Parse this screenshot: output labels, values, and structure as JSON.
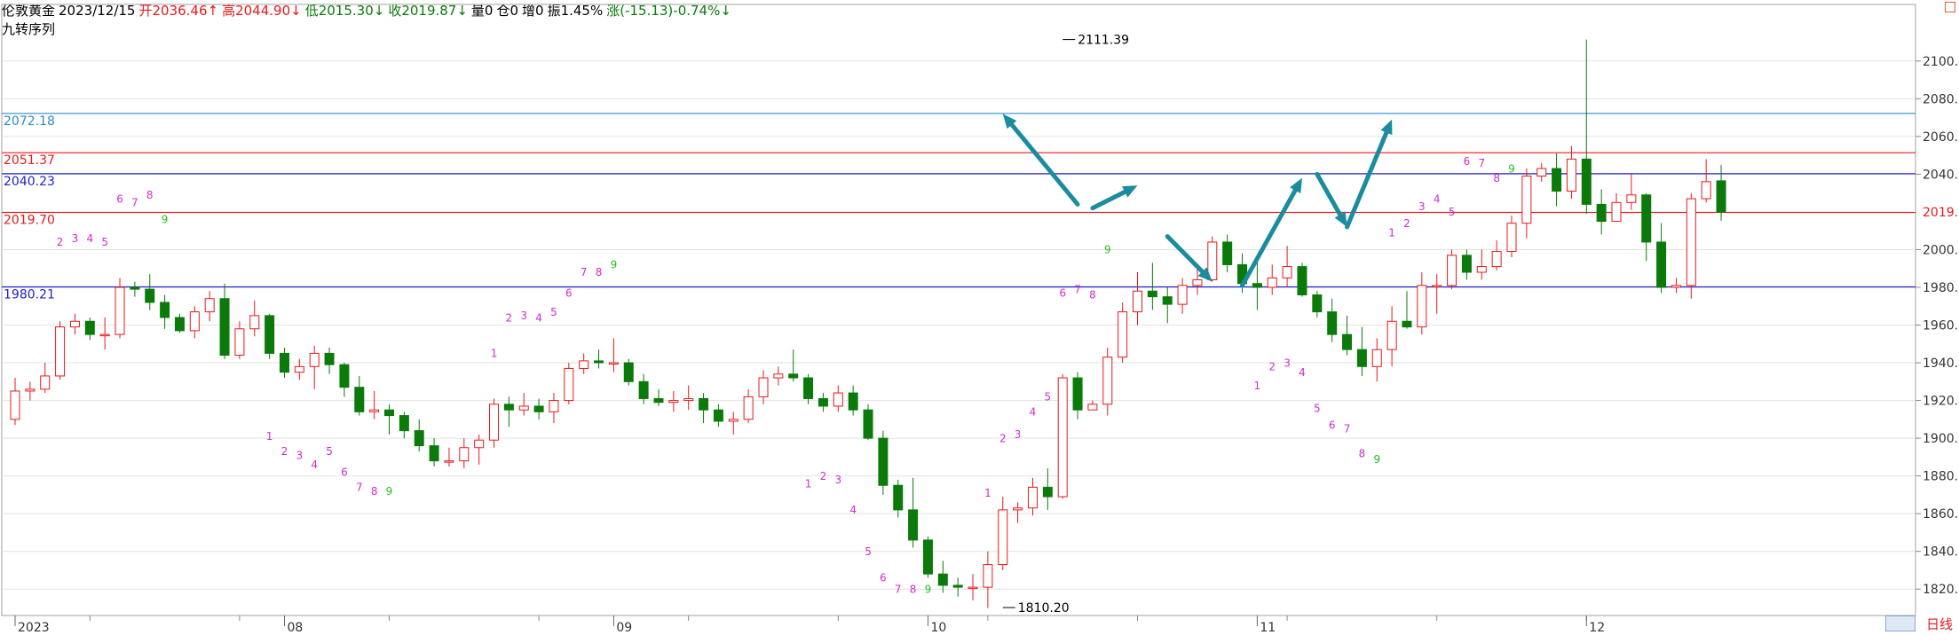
{
  "header": {
    "instrument": "伦敦黄金",
    "date": "2023/12/15",
    "open": "开2036.46↑",
    "high": "高2044.90↓",
    "low": "低2015.30↓",
    "close": "收2019.87↓",
    "volume": "量0",
    "position": "仓0",
    "increase": "增0",
    "amplitude": "振1.45%",
    "change": "涨(-15.13)-0.74%↓",
    "indicator": "九转序列"
  },
  "footer": {
    "period_label": "日线"
  },
  "colors": {
    "up": "#e8191c",
    "down": "#0b7a0b",
    "seq_down": "#d42bd4",
    "seq_up": "#22c022",
    "arrow": "#1a8c9e"
  },
  "chart_data": {
    "type": "candlestick",
    "ylim": [
      1806,
      2130
    ],
    "y_ticks": [
      1820,
      1840,
      1860,
      1880,
      1900,
      1920,
      1940,
      1960,
      1980,
      2000,
      2020,
      2040,
      2060,
      2080,
      2100
    ],
    "y_tick_labels": [
      "1820.00",
      "1840.00",
      "1860.00",
      "1880.00",
      "1900.00",
      "1920.00",
      "1940.00",
      "1960.00",
      "1980.00",
      "2000.00",
      "2020.00",
      "2040.00",
      "2060.00",
      "2080.00",
      "2100.00"
    ],
    "x_labels": [
      {
        "bar": 0,
        "text": "2023"
      },
      {
        "bar": 18,
        "text": "08"
      },
      {
        "bar": 40,
        "text": "09"
      },
      {
        "bar": 61,
        "text": "10"
      },
      {
        "bar": 83,
        "text": "11"
      },
      {
        "bar": 105,
        "text": "12"
      }
    ],
    "levels": [
      {
        "value": 2072.18,
        "label": "2072.18",
        "color": "#2a8fc7"
      },
      {
        "value": 2051.37,
        "label": "2051.37",
        "color": "#e8191c"
      },
      {
        "value": 2040.23,
        "label": "2040.23",
        "color": "#2222cc"
      },
      {
        "value": 2019.7,
        "label": "2019.70",
        "color": "#e8191c"
      },
      {
        "value": 1980.21,
        "label": "1980.21",
        "color": "#2222cc"
      }
    ],
    "last_price": "2019.87",
    "candles": [
      [
        1910,
        1925,
        1907,
        1932
      ],
      [
        1925,
        1926,
        1920,
        1930
      ],
      [
        1926,
        1933,
        1924,
        1940
      ],
      [
        1933,
        1959,
        1931,
        1962
      ],
      [
        1959,
        1962,
        1955,
        1966
      ],
      [
        1962,
        1955,
        1952,
        1964
      ],
      [
        1955,
        1955,
        1947,
        1964
      ],
      [
        1955,
        1980,
        1953,
        1985
      ],
      [
        1980,
        1979,
        1975,
        1983
      ],
      [
        1979,
        1972,
        1968,
        1987
      ],
      [
        1972,
        1964,
        1958,
        1976
      ],
      [
        1964,
        1957,
        1956,
        1966
      ],
      [
        1957,
        1967,
        1953,
        1970
      ],
      [
        1967,
        1974,
        1962,
        1978
      ],
      [
        1974,
        1944,
        1942,
        1982
      ],
      [
        1944,
        1958,
        1942,
        1962
      ],
      [
        1958,
        1965,
        1954,
        1973
      ],
      [
        1965,
        1945,
        1942,
        1966
      ],
      [
        1945,
        1935,
        1932,
        1948
      ],
      [
        1935,
        1938,
        1931,
        1942
      ],
      [
        1938,
        1945,
        1926,
        1949
      ],
      [
        1945,
        1939,
        1934,
        1948
      ],
      [
        1939,
        1927,
        1922,
        1940
      ],
      [
        1927,
        1914,
        1912,
        1933
      ],
      [
        1914,
        1915,
        1910,
        1925
      ],
      [
        1915,
        1912,
        1902,
        1918
      ],
      [
        1912,
        1904,
        1900,
        1914
      ],
      [
        1904,
        1896,
        1893,
        1910
      ],
      [
        1896,
        1888,
        1885,
        1900
      ],
      [
        1888,
        1888,
        1885,
        1895
      ],
      [
        1888,
        1895,
        1884,
        1900
      ],
      [
        1895,
        1899,
        1886,
        1902
      ],
      [
        1899,
        1918,
        1895,
        1921
      ],
      [
        1918,
        1915,
        1906,
        1922
      ],
      [
        1915,
        1917,
        1912,
        1924
      ],
      [
        1917,
        1914,
        1910,
        1921
      ],
      [
        1914,
        1920,
        1908,
        1924
      ],
      [
        1920,
        1937,
        1918,
        1940
      ],
      [
        1937,
        1941,
        1934,
        1945
      ],
      [
        1941,
        1940,
        1937,
        1947
      ],
      [
        1940,
        1940,
        1935,
        1953
      ],
      [
        1940,
        1930,
        1928,
        1942
      ],
      [
        1930,
        1921,
        1918,
        1934
      ],
      [
        1921,
        1919,
        1917,
        1926
      ],
      [
        1919,
        1920,
        1914,
        1925
      ],
      [
        1920,
        1921,
        1915,
        1928
      ],
      [
        1921,
        1915,
        1908,
        1924
      ],
      [
        1915,
        1909,
        1906,
        1918
      ],
      [
        1909,
        1910,
        1902,
        1914
      ],
      [
        1910,
        1922,
        1908,
        1926
      ],
      [
        1922,
        1932,
        1918,
        1936
      ],
      [
        1932,
        1934,
        1928,
        1938
      ],
      [
        1934,
        1932,
        1930,
        1947
      ],
      [
        1932,
        1921,
        1918,
        1934
      ],
      [
        1921,
        1917,
        1914,
        1924
      ],
      [
        1917,
        1924,
        1914,
        1928
      ],
      [
        1924,
        1915,
        1912,
        1928
      ],
      [
        1915,
        1900,
        1899,
        1918
      ],
      [
        1900,
        1875,
        1870,
        1904
      ],
      [
        1875,
        1862,
        1858,
        1878
      ],
      [
        1862,
        1846,
        1842,
        1879
      ],
      [
        1846,
        1828,
        1826,
        1848
      ],
      [
        1828,
        1822,
        1818,
        1835
      ],
      [
        1822,
        1821,
        1816,
        1826
      ],
      [
        1821,
        1821,
        1814,
        1828
      ],
      [
        1821,
        1833,
        1810,
        1840
      ],
      [
        1833,
        1862,
        1830,
        1869
      ],
      [
        1862,
        1863,
        1855,
        1866
      ],
      [
        1863,
        1874,
        1859,
        1879
      ],
      [
        1874,
        1869,
        1862,
        1884
      ],
      [
        1869,
        1932,
        1868,
        1934
      ],
      [
        1932,
        1915,
        1910,
        1935
      ],
      [
        1915,
        1918,
        1915,
        1920
      ],
      [
        1918,
        1943,
        1912,
        1948
      ],
      [
        1943,
        1967,
        1940,
        1972
      ],
      [
        1967,
        1978,
        1960,
        1988
      ],
      [
        1978,
        1975,
        1968,
        1993
      ],
      [
        1975,
        1971,
        1961,
        1980
      ],
      [
        1971,
        1981,
        1966,
        1985
      ],
      [
        1981,
        1984,
        1976,
        1991
      ],
      [
        1984,
        2004,
        1983,
        2007
      ],
      [
        2004,
        1992,
        1988,
        2008
      ],
      [
        1992,
        1982,
        1977,
        1998
      ],
      [
        1982,
        1980,
        1968,
        1994
      ],
      [
        1980,
        1985,
        1976,
        1992
      ],
      [
        1985,
        1991,
        1980,
        2002
      ],
      [
        1991,
        1976,
        1975,
        1993
      ],
      [
        1976,
        1967,
        1964,
        1978
      ],
      [
        1967,
        1955,
        1951,
        1974
      ],
      [
        1955,
        1947,
        1944,
        1965
      ],
      [
        1947,
        1938,
        1933,
        1959
      ],
      [
        1938,
        1947,
        1930,
        1953
      ],
      [
        1947,
        1962,
        1938,
        1970
      ],
      [
        1962,
        1959,
        1958,
        1978
      ],
      [
        1959,
        1981,
        1955,
        1988
      ],
      [
        1981,
        1981,
        1966,
        1987
      ],
      [
        1981,
        1997,
        1979,
        2000
      ],
      [
        1997,
        1988,
        1984,
        2000
      ],
      [
        1988,
        1991,
        1984,
        2000
      ],
      [
        1991,
        1999,
        1989,
        2005
      ],
      [
        1999,
        2014,
        1996,
        2018
      ],
      [
        2014,
        2039,
        2006,
        2043
      ],
      [
        2039,
        2043,
        2036,
        2046
      ],
      [
        2043,
        2031,
        2023,
        2051
      ],
      [
        2031,
        2048,
        2027,
        2055
      ],
      [
        2048,
        2024,
        2019,
        2111.39
      ],
      [
        2024,
        2015,
        2008,
        2032
      ],
      [
        2015,
        2025,
        2016,
        2030
      ],
      [
        2025,
        2029,
        2021,
        2040
      ],
      [
        2029,
        2004,
        1994,
        2030
      ],
      [
        2004,
        1980,
        1977,
        2014
      ],
      [
        1980,
        1981,
        1977,
        1985
      ],
      [
        1981,
        2027,
        1974,
        2030
      ],
      [
        2027,
        2036,
        2025,
        2048
      ],
      [
        2036.46,
        2019.87,
        2015.3,
        2044.9
      ]
    ],
    "annotations": [
      {
        "bar": 70,
        "price": 2111.39,
        "text": "2111.39"
      },
      {
        "bar": 66,
        "price": 1810.2,
        "text": "1810.20"
      }
    ],
    "td_sequence": [
      {
        "bar": 3,
        "price": 2002,
        "n": "2",
        "color": "seq_down"
      },
      {
        "bar": 4,
        "price": 2004,
        "n": "3",
        "color": "seq_down"
      },
      {
        "bar": 5,
        "price": 2004,
        "n": "4",
        "color": "seq_down"
      },
      {
        "bar": 6,
        "price": 2002,
        "n": "5",
        "color": "seq_down"
      },
      {
        "bar": 7,
        "price": 2025,
        "n": "6",
        "color": "seq_down"
      },
      {
        "bar": 8,
        "price": 2023,
        "n": "7",
        "color": "seq_down"
      },
      {
        "bar": 9,
        "price": 2027,
        "n": "8",
        "color": "seq_down"
      },
      {
        "bar": 10,
        "price": 2014,
        "n": "9",
        "color": "seq_up"
      },
      {
        "bar": 17,
        "price": 1899,
        "n": "1",
        "color": "seq_down"
      },
      {
        "bar": 18,
        "price": 1891,
        "n": "2",
        "color": "seq_down"
      },
      {
        "bar": 19,
        "price": 1889,
        "n": "3",
        "color": "seq_down"
      },
      {
        "bar": 20,
        "price": 1884,
        "n": "4",
        "color": "seq_down"
      },
      {
        "bar": 21,
        "price": 1891,
        "n": "5",
        "color": "seq_down"
      },
      {
        "bar": 22,
        "price": 1880,
        "n": "6",
        "color": "seq_down"
      },
      {
        "bar": 23,
        "price": 1872,
        "n": "7",
        "color": "seq_down"
      },
      {
        "bar": 24,
        "price": 1870,
        "n": "8",
        "color": "seq_down"
      },
      {
        "bar": 25,
        "price": 1870,
        "n": "9",
        "color": "seq_up"
      },
      {
        "bar": 32,
        "price": 1943,
        "n": "1",
        "color": "seq_down"
      },
      {
        "bar": 33,
        "price": 1962,
        "n": "2",
        "color": "seq_down"
      },
      {
        "bar": 34,
        "price": 1963,
        "n": "3",
        "color": "seq_down"
      },
      {
        "bar": 35,
        "price": 1962,
        "n": "4",
        "color": "seq_down"
      },
      {
        "bar": 36,
        "price": 1965,
        "n": "5",
        "color": "seq_down"
      },
      {
        "bar": 37,
        "price": 1975,
        "n": "6",
        "color": "seq_down"
      },
      {
        "bar": 38,
        "price": 1986,
        "n": "7",
        "color": "seq_down"
      },
      {
        "bar": 39,
        "price": 1986,
        "n": "8",
        "color": "seq_down"
      },
      {
        "bar": 40,
        "price": 1990,
        "n": "9",
        "color": "seq_up"
      },
      {
        "bar": 53,
        "price": 1874,
        "n": "1",
        "color": "seq_down"
      },
      {
        "bar": 54,
        "price": 1878,
        "n": "2",
        "color": "seq_down"
      },
      {
        "bar": 55,
        "price": 1876,
        "n": "3",
        "color": "seq_down"
      },
      {
        "bar": 56,
        "price": 1860,
        "n": "4",
        "color": "seq_down"
      },
      {
        "bar": 57,
        "price": 1838,
        "n": "5",
        "color": "seq_down"
      },
      {
        "bar": 58,
        "price": 1824,
        "n": "6",
        "color": "seq_down"
      },
      {
        "bar": 59,
        "price": 1818,
        "n": "7",
        "color": "seq_down"
      },
      {
        "bar": 60,
        "price": 1818,
        "n": "8",
        "color": "seq_down"
      },
      {
        "bar": 61,
        "price": 1818,
        "n": "9",
        "color": "seq_up"
      },
      {
        "bar": 65,
        "price": 1869,
        "n": "1",
        "color": "seq_down"
      },
      {
        "bar": 66,
        "price": 1898,
        "n": "2",
        "color": "seq_down"
      },
      {
        "bar": 67,
        "price": 1900,
        "n": "3",
        "color": "seq_down"
      },
      {
        "bar": 68,
        "price": 1912,
        "n": "4",
        "color": "seq_down"
      },
      {
        "bar": 69,
        "price": 1920,
        "n": "5",
        "color": "seq_down"
      },
      {
        "bar": 70,
        "price": 1975,
        "n": "6",
        "color": "seq_down"
      },
      {
        "bar": 71,
        "price": 1977,
        "n": "7",
        "color": "seq_down"
      },
      {
        "bar": 72,
        "price": 1974,
        "n": "8",
        "color": "seq_down"
      },
      {
        "bar": 73,
        "price": 1998,
        "n": "9",
        "color": "seq_up"
      },
      {
        "bar": 83,
        "price": 1926,
        "n": "1",
        "color": "seq_down"
      },
      {
        "bar": 84,
        "price": 1936,
        "n": "2",
        "color": "seq_down"
      },
      {
        "bar": 85,
        "price": 1938,
        "n": "3",
        "color": "seq_down"
      },
      {
        "bar": 86,
        "price": 1933,
        "n": "4",
        "color": "seq_down"
      },
      {
        "bar": 87,
        "price": 1914,
        "n": "5",
        "color": "seq_down"
      },
      {
        "bar": 88,
        "price": 1905,
        "n": "6",
        "color": "seq_down"
      },
      {
        "bar": 89,
        "price": 1903,
        "n": "7",
        "color": "seq_down"
      },
      {
        "bar": 90,
        "price": 1890,
        "n": "8",
        "color": "seq_down"
      },
      {
        "bar": 91,
        "price": 1887,
        "n": "9",
        "color": "seq_up"
      },
      {
        "bar": 92,
        "price": 2007,
        "n": "1",
        "color": "seq_down"
      },
      {
        "bar": 93,
        "price": 2012,
        "n": "2",
        "color": "seq_down"
      },
      {
        "bar": 94,
        "price": 2021,
        "n": "3",
        "color": "seq_down"
      },
      {
        "bar": 95,
        "price": 2025,
        "n": "4",
        "color": "seq_down"
      },
      {
        "bar": 96,
        "price": 2018,
        "n": "5",
        "color": "seq_down"
      },
      {
        "bar": 97,
        "price": 2045,
        "n": "6",
        "color": "seq_down"
      },
      {
        "bar": 98,
        "price": 2044,
        "n": "7",
        "color": "seq_down"
      },
      {
        "bar": 99,
        "price": 2036,
        "n": "8",
        "color": "seq_down"
      },
      {
        "bar": 100,
        "price": 2041,
        "n": "9",
        "color": "seq_up"
      }
    ],
    "arrows": [
      {
        "from": [
          71,
          2024
        ],
        "to": [
          66,
          2072
        ]
      },
      {
        "from": [
          72,
          2022
        ],
        "to": [
          75,
          2034
        ]
      },
      {
        "from": [
          77,
          2007
        ],
        "to": [
          80,
          1983
        ]
      },
      {
        "from": [
          82,
          1981
        ],
        "to": [
          86,
          2038
        ]
      },
      {
        "from": [
          87,
          2040
        ],
        "to": [
          89,
          2012
        ]
      },
      {
        "from": [
          89,
          2012
        ],
        "to": [
          92,
          2069
        ]
      }
    ]
  }
}
